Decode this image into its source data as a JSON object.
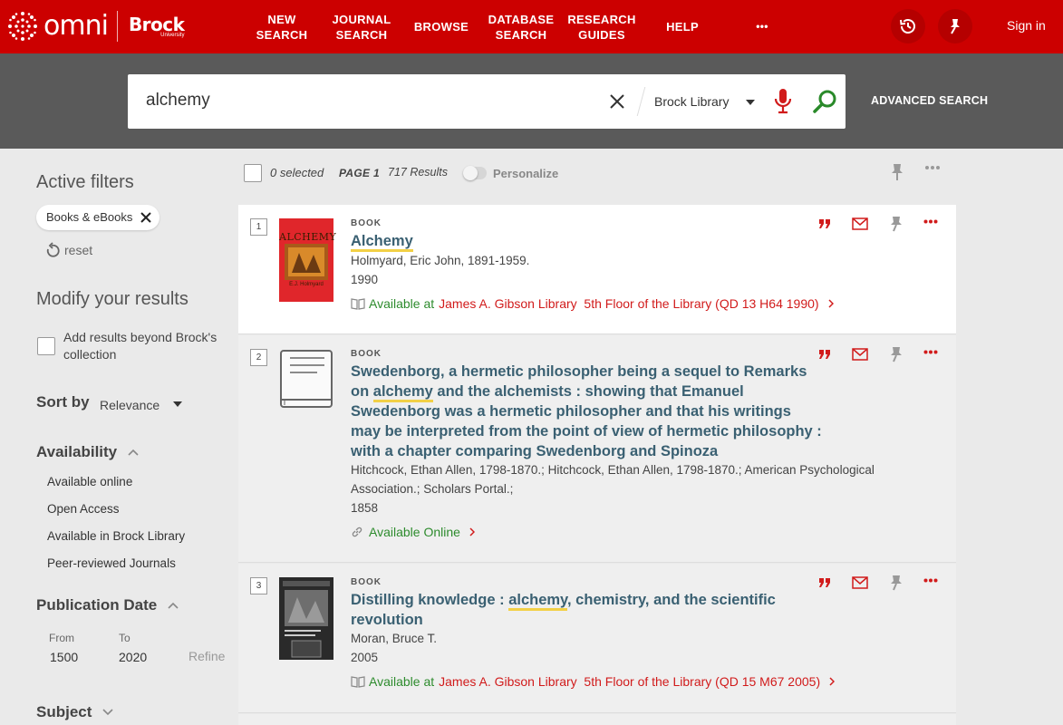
{
  "app": {
    "logo_text": "omni",
    "brand_name": "Brock",
    "brand_sub": "University"
  },
  "nav": [
    {
      "line1": "NEW",
      "line2": "SEARCH"
    },
    {
      "line1": "JOURNAL",
      "line2": "SEARCH"
    },
    {
      "line1": "BROWSE",
      "line2": ""
    },
    {
      "line1": "DATABASE",
      "line2": "SEARCH"
    },
    {
      "line1": "RESEARCH",
      "line2": "GUIDES"
    },
    {
      "line1": "HELP",
      "line2": ""
    },
    {
      "line1": "•••",
      "line2": ""
    }
  ],
  "header": {
    "signin": "Sign in",
    "history_icon": "history-icon",
    "pin_icon": "pin-icon"
  },
  "search": {
    "query": "alchemy",
    "scope": "Brock Library",
    "advanced": "ADVANCED SEARCH"
  },
  "sidebar": {
    "active_filters_title": "Active filters",
    "active_filter": "Books & eBooks",
    "reset": "reset",
    "modify_title": "Modify your results",
    "add_beyond": "Add results beyond Brock's collection",
    "sort_label": "Sort by",
    "sort_value": "Relevance",
    "availability_title": "Availability",
    "availability_items": [
      "Available online",
      "Open Access",
      "Available in Brock Library",
      "Peer-reviewed Journals"
    ],
    "pubdate_title": "Publication Date",
    "from_label": "From",
    "to_label": "To",
    "from_value": "1500",
    "to_value": "2020",
    "refine": "Refine",
    "subject_title": "Subject"
  },
  "results_header": {
    "selected": "0 selected",
    "page": "PAGE 1",
    "count": "717 Results",
    "personalize": "Personalize"
  },
  "results": [
    {
      "num": "1",
      "type": "BOOK",
      "title_pre": "",
      "title_hl": "Alchemy",
      "title_post": "",
      "author": "Holmyard, Eric John, 1891-1959.",
      "year": "1990",
      "avail_prefix": "Available at",
      "avail_location": "James A. Gibson Library  5th Floor of the Library (QD 13 H64 1990)",
      "cover_title": "ALCHEMY",
      "cover_author": "E.J. Holmyard"
    },
    {
      "num": "2",
      "type": "BOOK",
      "title_pre": "Swedenborg, a hermetic philosopher being a sequel to Remarks on",
      "title_hl": "alchemy",
      "title_post": "and the alchemists : showing that Emanuel Swedenborg was a hermetic philosopher and that his writings may be interpreted from the point of view of hermetic philosophy : with a chapter comparing Swedenborg and Spinoza",
      "author": "Hitchcock, Ethan Allen, 1798-1870.; Hitchcock, Ethan Allen, 1798-1870.; American Psychological Association.; Scholars Portal.;",
      "year": "1858",
      "avail_prefix": "Available Online",
      "avail_location": ""
    },
    {
      "num": "3",
      "type": "BOOK",
      "title_pre": "Distilling knowledge :",
      "title_hl": "alchemy",
      "title_post": ", chemistry, and the scientific revolution",
      "author": "Moran, Bruce T.",
      "year": "2005",
      "avail_prefix": "Available at",
      "avail_location": "James A. Gibson Library  5th Floor of the Library (QD 15 M67 2005)"
    }
  ],
  "colors": {
    "brand_red": "#cc0000",
    "search_strip": "#5a5a5a",
    "title_link": "#3a6072",
    "available_green": "#2d8b2d",
    "location_red": "#d11b1b",
    "highlight": "#f2d046"
  }
}
